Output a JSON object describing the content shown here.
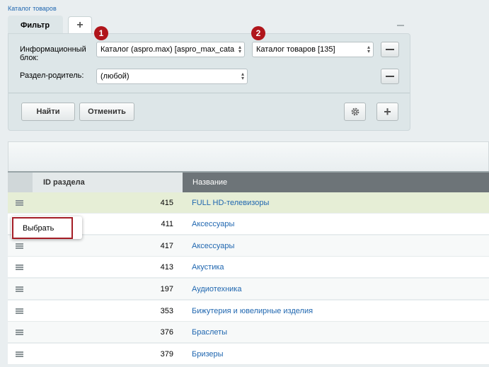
{
  "breadcrumb": "Каталог товаров",
  "filter": {
    "tab_label": "Фильтр",
    "add_tab_label": "+",
    "fields": {
      "infoblock_label_line1": "Информационный",
      "infoblock_label_line2": "блок:",
      "infoblock_type_value": "Каталог (aspro.max) [aspro_max_cata",
      "infoblock_value": "Каталог товаров [135]",
      "section_label": "Раздел-родитель:",
      "section_value": "(любой)"
    },
    "find_button": "Найти",
    "cancel_button": "Отменить",
    "add_button": "+"
  },
  "annotations": {
    "badge1": "1",
    "badge2": "2"
  },
  "grid": {
    "columns": {
      "id": "ID раздела",
      "name": "Название"
    },
    "rows": [
      {
        "id": "415",
        "name": "FULL HD-телевизоры"
      },
      {
        "id": "411",
        "name": "Аксессуары"
      },
      {
        "id": "417",
        "name": "Аксессуары"
      },
      {
        "id": "413",
        "name": "Акустика"
      },
      {
        "id": "197",
        "name": "Аудиотехника"
      },
      {
        "id": "353",
        "name": "Бижутерия и ювелирные изделия"
      },
      {
        "id": "376",
        "name": "Браслеты"
      },
      {
        "id": "379",
        "name": "Бризеры"
      }
    ]
  },
  "context_menu": {
    "select_label": "Выбрать"
  },
  "colors": {
    "link": "#2067b0",
    "highlight_row": "#e6eed6",
    "badge": "#b0151b",
    "header_active": "#6d7478"
  },
  "icons": {
    "hamburger": "menu-icon",
    "gear": "gear-icon",
    "select_arrow": "chevron-updown-icon"
  }
}
